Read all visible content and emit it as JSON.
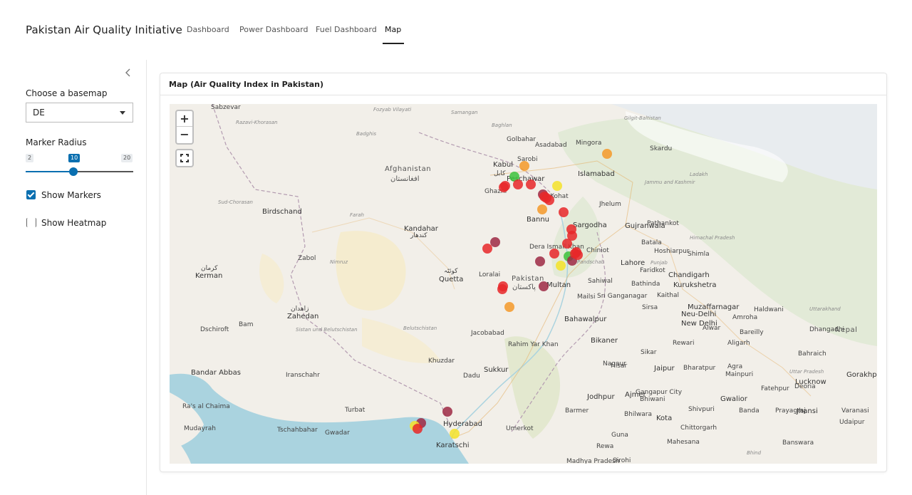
{
  "app": {
    "title": "Pakistan Air Quality Initiative",
    "nav": [
      {
        "label": "Dashboard",
        "active": false
      },
      {
        "label": "Power Dashboard",
        "active": false
      },
      {
        "label": "Fuel Dashboard",
        "active": false
      },
      {
        "label": "Map",
        "active": true
      }
    ]
  },
  "sidebar": {
    "collapse_icon": "chevron-left-icon",
    "basemap_label": "Choose a basemap",
    "basemap_value": "DE",
    "radius_label": "Marker Radius",
    "radius_min": "2",
    "radius_max": "20",
    "radius_value": "10",
    "radius_level": 0.444,
    "show_markers_label": "Show Markers",
    "show_markers_checked": true,
    "show_heatmap_label": "Show Heatmap",
    "show_heatmap_checked": false
  },
  "card": {
    "title": "Map (Air Quality Index in Pakistan)"
  },
  "map": {
    "zoom_in": "+",
    "zoom_out": "−",
    "fullscreen_icon": "fullscreen-icon",
    "colors": {
      "land": "#f2efe9",
      "sea": "#aad3df",
      "good": "#3cc33c",
      "moderate": "#f5e32a",
      "sensitive": "#f59a2a",
      "unhealthy": "#e8282a",
      "very_unhealthy": "#9e2a45"
    },
    "labels": [
      {
        "text": "Sabzevar"
      },
      {
        "text": "Fozyab Vilayati"
      },
      {
        "text": "Samangan"
      },
      {
        "text": "Baghlan"
      },
      {
        "text": "Badghis"
      },
      {
        "text": "Afghanistan"
      },
      {
        "text": "افغانستان"
      },
      {
        "text": "Kabul"
      },
      {
        "text": "کابل"
      },
      {
        "text": "Ghazni"
      },
      {
        "text": "Razavi-Khorasan"
      },
      {
        "text": "Birdschand"
      },
      {
        "text": "Sud-Chorasan"
      },
      {
        "text": "Farah"
      },
      {
        "text": "Kandahar"
      },
      {
        "text": "کندهار"
      },
      {
        "text": "Zabol"
      },
      {
        "text": "Nimruz"
      },
      {
        "text": "Kerman"
      },
      {
        "text": "کرمان"
      },
      {
        "text": "Zahedan"
      },
      {
        "text": "زاهدان"
      },
      {
        "text": "Bam"
      },
      {
        "text": "Dschiroft"
      },
      {
        "text": "Sistan und Belutschistan"
      },
      {
        "text": "Quetta"
      },
      {
        "text": "کوئٹہ"
      },
      {
        "text": "Loralai"
      },
      {
        "text": "Pakistan"
      },
      {
        "text": "پاکستان"
      },
      {
        "text": "Belutschistan"
      },
      {
        "text": "Jacobabad"
      },
      {
        "text": "Khuzdar"
      },
      {
        "text": "Sukkur"
      },
      {
        "text": "Rahim Yar Khan"
      },
      {
        "text": "Hyderabad"
      },
      {
        "text": "Karatschi"
      },
      {
        "text": "Umerkot"
      },
      {
        "text": "Dadu"
      },
      {
        "text": "Turbat"
      },
      {
        "text": "Gwadar"
      },
      {
        "text": "Tschahbahar"
      },
      {
        "text": "Iranschahr"
      },
      {
        "text": "Bandar Abbas"
      },
      {
        "text": "Mudayrah"
      },
      {
        "text": "Ra's al Chaima"
      },
      {
        "text": "Peschawar"
      },
      {
        "text": "Kohat"
      },
      {
        "text": "Bannu"
      },
      {
        "text": "Dera Ismail Khan"
      },
      {
        "text": "Sargodha"
      },
      {
        "text": "Islamabad"
      },
      {
        "text": "Jhelum"
      },
      {
        "text": "Gujranwala"
      },
      {
        "text": "Lahore"
      },
      {
        "text": "Chiniot"
      },
      {
        "text": "Sahiwal"
      },
      {
        "text": "Multan"
      },
      {
        "text": "Mailsi"
      },
      {
        "text": "Bahawalpur"
      },
      {
        "text": "Pandschab"
      },
      {
        "text": "Mingora"
      },
      {
        "text": "Asadabad"
      },
      {
        "text": "Golbahar"
      },
      {
        "text": "Sarobi"
      },
      {
        "text": "Gilgit-Baltistan"
      },
      {
        "text": "Skardu"
      },
      {
        "text": "Ladakh"
      },
      {
        "text": "Jammu and Kashmir"
      },
      {
        "text": "Pathankot"
      },
      {
        "text": "Batala"
      },
      {
        "text": "Hoshiarpur"
      },
      {
        "text": "Himachal Pradesh"
      },
      {
        "text": "Shimla"
      },
      {
        "text": "Faridkot"
      },
      {
        "text": "Punjab"
      },
      {
        "text": "Bathinda"
      },
      {
        "text": "Chandigarh"
      },
      {
        "text": "Kurukshetra"
      },
      {
        "text": "Sri Ganganagar"
      },
      {
        "text": "Sirsa"
      },
      {
        "text": "Kaithal"
      },
      {
        "text": "Muzaffarnagar"
      },
      {
        "text": "Uttarakhand"
      },
      {
        "text": "Haldwani"
      },
      {
        "text": "Neu-Delhi"
      },
      {
        "text": "New Delhi"
      },
      {
        "text": "Amroha"
      },
      {
        "text": "Bareilly"
      },
      {
        "text": "Dhangadhi"
      },
      {
        "text": "Nepal"
      },
      {
        "text": "Bikaner"
      },
      {
        "text": "Sikar"
      },
      {
        "text": "Rewari"
      },
      {
        "text": "Aligarh"
      },
      {
        "text": "Alwar"
      },
      {
        "text": "Bahraich"
      },
      {
        "text": "Nagaur"
      },
      {
        "text": "Jaipur"
      },
      {
        "text": "Bharatpur"
      },
      {
        "text": "Agra"
      },
      {
        "text": "Mainpuri"
      },
      {
        "text": "Uttar Pradesh"
      },
      {
        "text": "Lucknow"
      },
      {
        "text": "Gorakhpur"
      },
      {
        "text": "Jodhpur"
      },
      {
        "text": "Ajmer"
      },
      {
        "text": "Gangapur City"
      },
      {
        "text": "Gwalior"
      },
      {
        "text": "Fatehpur"
      },
      {
        "text": "Deoria"
      },
      {
        "text": "Barmer"
      },
      {
        "text": "Bhilwara"
      },
      {
        "text": "Kota"
      },
      {
        "text": "Shivpuri"
      },
      {
        "text": "Banda"
      },
      {
        "text": "Prayagraj"
      },
      {
        "text": "Jhansi"
      },
      {
        "text": "Varanasi"
      },
      {
        "text": "Chittorgarh"
      },
      {
        "text": "Udaipur"
      },
      {
        "text": "Guna"
      },
      {
        "text": "Rewa"
      },
      {
        "text": "Mahesana"
      },
      {
        "text": "Banswara"
      },
      {
        "text": "Madhya Pradesh"
      },
      {
        "text": "Sirohi"
      },
      {
        "text": "Bhind"
      },
      {
        "text": "Hisar"
      },
      {
        "text": "Bhiwani"
      }
    ],
    "markers": [
      {
        "lon": 75.55,
        "lat": 35.3,
        "aqi": "sensitive"
      },
      {
        "lon": 72.35,
        "lat": 34.82,
        "aqi": "sensitive"
      },
      {
        "lon": 71.95,
        "lat": 34.4,
        "aqi": "good"
      },
      {
        "lon": 71.6,
        "lat": 34.05,
        "aqi": "unhealthy"
      },
      {
        "lon": 71.55,
        "lat": 34.0,
        "aqi": "unhealthy"
      },
      {
        "lon": 72.1,
        "lat": 34.1,
        "aqi": "unhealthy"
      },
      {
        "lon": 72.6,
        "lat": 34.12,
        "aqi": "unhealthy"
      },
      {
        "lon": 73.05,
        "lat": 33.72,
        "aqi": "very_unhealthy"
      },
      {
        "lon": 73.12,
        "lat": 33.65,
        "aqi": "unhealthy"
      },
      {
        "lon": 73.2,
        "lat": 33.6,
        "aqi": "unhealthy"
      },
      {
        "lon": 73.3,
        "lat": 33.5,
        "aqi": "unhealthy"
      },
      {
        "lon": 73.6,
        "lat": 34.05,
        "aqi": "moderate"
      },
      {
        "lon": 73.02,
        "lat": 33.15,
        "aqi": "sensitive"
      },
      {
        "lon": 73.85,
        "lat": 33.05,
        "aqi": "unhealthy"
      },
      {
        "lon": 74.18,
        "lat": 32.15,
        "aqi": "unhealthy"
      },
      {
        "lon": 74.15,
        "lat": 32.4,
        "aqi": "unhealthy"
      },
      {
        "lon": 74.0,
        "lat": 31.85,
        "aqi": "unhealthy"
      },
      {
        "lon": 73.5,
        "lat": 31.45,
        "aqi": "unhealthy"
      },
      {
        "lon": 74.05,
        "lat": 31.35,
        "aqi": "good"
      },
      {
        "lon": 74.2,
        "lat": 31.2,
        "aqi": "very_unhealthy"
      },
      {
        "lon": 74.35,
        "lat": 31.52,
        "aqi": "unhealthy"
      },
      {
        "lon": 74.3,
        "lat": 31.45,
        "aqi": "unhealthy"
      },
      {
        "lon": 74.4,
        "lat": 31.4,
        "aqi": "unhealthy"
      },
      {
        "lon": 73.75,
        "lat": 31.0,
        "aqi": "moderate"
      },
      {
        "lon": 72.95,
        "lat": 31.15,
        "aqi": "very_unhealthy"
      },
      {
        "lon": 71.2,
        "lat": 31.9,
        "aqi": "very_unhealthy"
      },
      {
        "lon": 70.9,
        "lat": 31.65,
        "aqi": "unhealthy"
      },
      {
        "lon": 73.1,
        "lat": 30.2,
        "aqi": "very_unhealthy"
      },
      {
        "lon": 71.5,
        "lat": 30.2,
        "aqi": "unhealthy"
      },
      {
        "lon": 71.48,
        "lat": 30.1,
        "aqi": "unhealthy"
      },
      {
        "lon": 71.75,
        "lat": 29.4,
        "aqi": "sensitive"
      },
      {
        "lon": 69.35,
        "lat": 25.4,
        "aqi": "very_unhealthy"
      },
      {
        "lon": 68.35,
        "lat": 24.95,
        "aqi": "very_unhealthy"
      },
      {
        "lon": 68.1,
        "lat": 24.85,
        "aqi": "moderate"
      },
      {
        "lon": 68.2,
        "lat": 24.75,
        "aqi": "unhealthy"
      },
      {
        "lon": 69.65,
        "lat": 24.55,
        "aqi": "moderate"
      }
    ]
  }
}
